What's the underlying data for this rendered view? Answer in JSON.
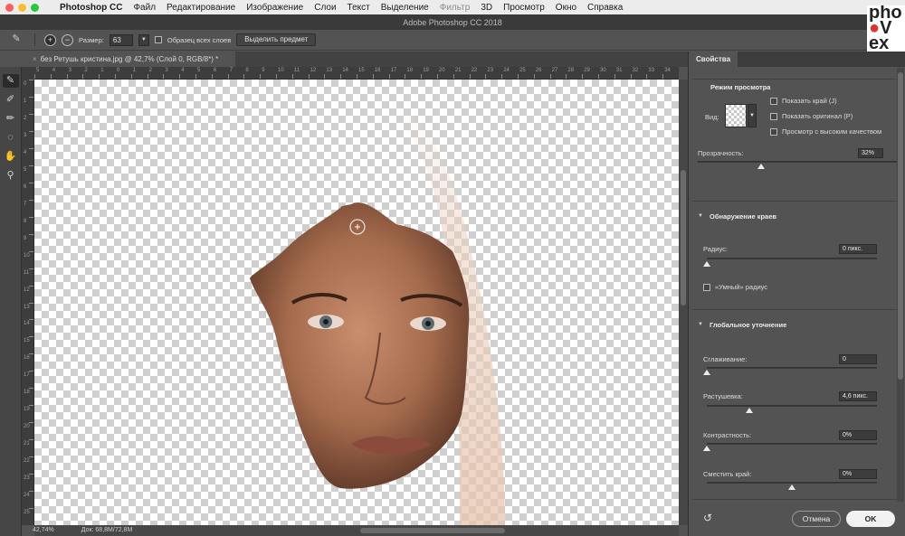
{
  "menubar": {
    "app": "Photoshop CC",
    "items": [
      "Файл",
      "Редактирование",
      "Изображение",
      "Слои",
      "Текст",
      "Выделение",
      "Фильтр",
      "3D",
      "Просмотр",
      "Окно",
      "Справка"
    ],
    "traffic_colors": [
      "#fc5f57",
      "#fdbc2e",
      "#27c840"
    ]
  },
  "window": {
    "title": "Adobe Photoshop CC 2018"
  },
  "options": {
    "size_label": "Размер:",
    "size_value": "63",
    "sample_all_label": "Образец всех слоев",
    "select_subject_label": "Выделить предмет"
  },
  "document": {
    "tab_title": "без Ретушь кристина.jpg @ 42,7% (Слой 0, RGB/8*) *",
    "close_glyph": "×"
  },
  "rulers": {
    "h_ticks": [
      "5",
      "4",
      "3",
      "2",
      "1",
      "0",
      "1",
      "2",
      "3",
      "4",
      "5",
      "6",
      "7",
      "8",
      "9",
      "10",
      "11",
      "12",
      "13",
      "14",
      "15",
      "16",
      "17",
      "18",
      "19",
      "20",
      "21",
      "22",
      "23",
      "24",
      "25",
      "26",
      "27",
      "28",
      "29",
      "30",
      "31",
      "32",
      "33",
      "34"
    ],
    "v_ticks": [
      "0",
      "1",
      "2",
      "3",
      "4",
      "5",
      "6",
      "7",
      "8",
      "9",
      "10",
      "11",
      "12",
      "13",
      "14",
      "15",
      "16",
      "17",
      "18",
      "19",
      "20",
      "21",
      "22",
      "23",
      "24",
      "25"
    ]
  },
  "status": {
    "zoom": "42,74%",
    "doc": "Док: 68,8M/72,8M"
  },
  "panel": {
    "tab": "Свойства",
    "view_mode": {
      "title": "Режим просмотра",
      "view_label": "Вид:",
      "show_edge": "Показать край (J)",
      "show_original": "Показать оригинал (P)",
      "high_quality": "Просмотр с высоким качеством"
    },
    "opacity": {
      "label": "Прозрачность:",
      "value": "32%",
      "fraction": 0.32
    },
    "edge_detection": {
      "title": "Обнаружение краев",
      "radius_label": "Радиус:",
      "radius_value": "0 пикс.",
      "radius_fraction": 0.0,
      "smart_radius": "«Умный» радиус"
    },
    "global_refine": {
      "title": "Глобальное уточнение",
      "smooth_label": "Сглаживание:",
      "smooth_value": "0",
      "smooth_fraction": 0.0,
      "feather_label": "Растушевка:",
      "feather_value": "4,6 пикс.",
      "feather_fraction": 0.25,
      "contrast_label": "Контрастность:",
      "contrast_value": "0%",
      "contrast_fraction": 0.0,
      "shift_label": "Сместить край:",
      "shift_value": "0%",
      "shift_fraction": 0.5
    },
    "buttons": {
      "cancel": "Отмена",
      "ok": "OK"
    }
  }
}
